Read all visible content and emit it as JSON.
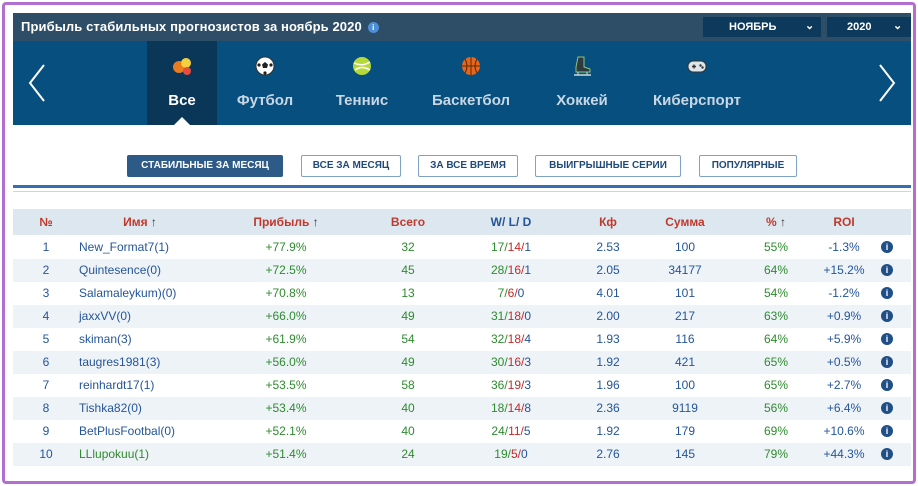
{
  "header": {
    "title": "Прибыль стабильных прогнозистов за ноябрь 2020",
    "info_icon": "i",
    "month_select": "НОЯБРЬ",
    "year_select": "2020"
  },
  "sports": [
    {
      "label": "Все",
      "icon": "all-sports-icon",
      "active": true
    },
    {
      "label": "Футбол",
      "icon": "soccer-ball-icon"
    },
    {
      "label": "Теннис",
      "icon": "tennis-ball-icon"
    },
    {
      "label": "Баскетбол",
      "icon": "basketball-icon"
    },
    {
      "label": "Хоккей",
      "icon": "hockey-skate-icon"
    },
    {
      "label": "Киберспорт",
      "icon": "gamepad-icon"
    }
  ],
  "filters": [
    {
      "label": "СТАБИЛЬНЫЕ ЗА МЕСЯЦ",
      "active": true
    },
    {
      "label": "ВСЕ ЗА МЕСЯЦ"
    },
    {
      "label": "ЗА ВСЕ ВРЕМЯ"
    },
    {
      "label": "ВЫИГРЫШНЫЕ СЕРИИ"
    },
    {
      "label": "ПОПУЛЯРНЫЕ"
    }
  ],
  "table": {
    "headers": {
      "no": "№",
      "name": "Имя",
      "profit": "Прибыль",
      "total": "Всего",
      "w": "W/",
      "l": "L/",
      "d": "D",
      "kf": "Кф",
      "sum": "Сумма",
      "pct": "%",
      "roi": "ROI"
    },
    "rows": [
      {
        "no": "1",
        "name": "New_Format7(1)",
        "profit": "+77.9%",
        "total": "32",
        "w": "17/",
        "l": "14/",
        "d": "1",
        "kf": "2.53",
        "sum": "100",
        "pct": "55%",
        "roi": "-1.3%"
      },
      {
        "no": "2",
        "name": "Quintesence(0)",
        "profit": "+72.5%",
        "total": "45",
        "w": "28/",
        "l": "16/",
        "d": "1",
        "kf": "2.05",
        "sum": "34177",
        "pct": "64%",
        "roi": "+15.2%"
      },
      {
        "no": "3",
        "name": "Salamaleykum)(0)",
        "profit": "+70.8%",
        "total": "13",
        "w": "7/",
        "l": "6/",
        "d": "0",
        "kf": "4.01",
        "sum": "101",
        "pct": "54%",
        "roi": "-1.2%"
      },
      {
        "no": "4",
        "name": "jaxxVV(0)",
        "profit": "+66.0%",
        "total": "49",
        "w": "31/",
        "l": "18/",
        "d": "0",
        "kf": "2.00",
        "sum": "217",
        "pct": "63%",
        "roi": "+0.9%"
      },
      {
        "no": "5",
        "name": "skiman(3)",
        "profit": "+61.9%",
        "total": "54",
        "w": "32/",
        "l": "18/",
        "d": "4",
        "kf": "1.93",
        "sum": "116",
        "pct": "64%",
        "roi": "+5.9%"
      },
      {
        "no": "6",
        "name": "taugres1981(3)",
        "profit": "+56.0%",
        "total": "49",
        "w": "30/",
        "l": "16/",
        "d": "3",
        "kf": "1.92",
        "sum": "421",
        "pct": "65%",
        "roi": "+0.5%"
      },
      {
        "no": "7",
        "name": "reinhardt17(1)",
        "profit": "+53.5%",
        "total": "58",
        "w": "36/",
        "l": "19/",
        "d": "3",
        "kf": "1.96",
        "sum": "100",
        "pct": "65%",
        "roi": "+2.7%"
      },
      {
        "no": "8",
        "name": "Tishka82(0)",
        "profit": "+53.4%",
        "total": "40",
        "w": "18/",
        "l": "14/",
        "d": "8",
        "kf": "2.36",
        "sum": "9119",
        "pct": "56%",
        "roi": "+6.4%"
      },
      {
        "no": "9",
        "name": "BetPlusFootbal(0)",
        "profit": "+52.1%",
        "total": "40",
        "w": "24/",
        "l": "11/",
        "d": "5",
        "kf": "1.92",
        "sum": "179",
        "pct": "69%",
        "roi": "+10.6%"
      },
      {
        "no": "10",
        "name": "LLlupokuu(1)",
        "profit": "+51.4%",
        "total": "24",
        "w": "19/",
        "l": "5/",
        "d": "0",
        "kf": "2.76",
        "sum": "145",
        "pct": "79%",
        "roi": "+44.3%"
      }
    ]
  },
  "colors": {
    "topbar": "#2e4d66",
    "sportbar": "#064f7f",
    "header_red": "#c0392b",
    "positive_green": "#2e8b2e",
    "link_blue": "#245599"
  }
}
